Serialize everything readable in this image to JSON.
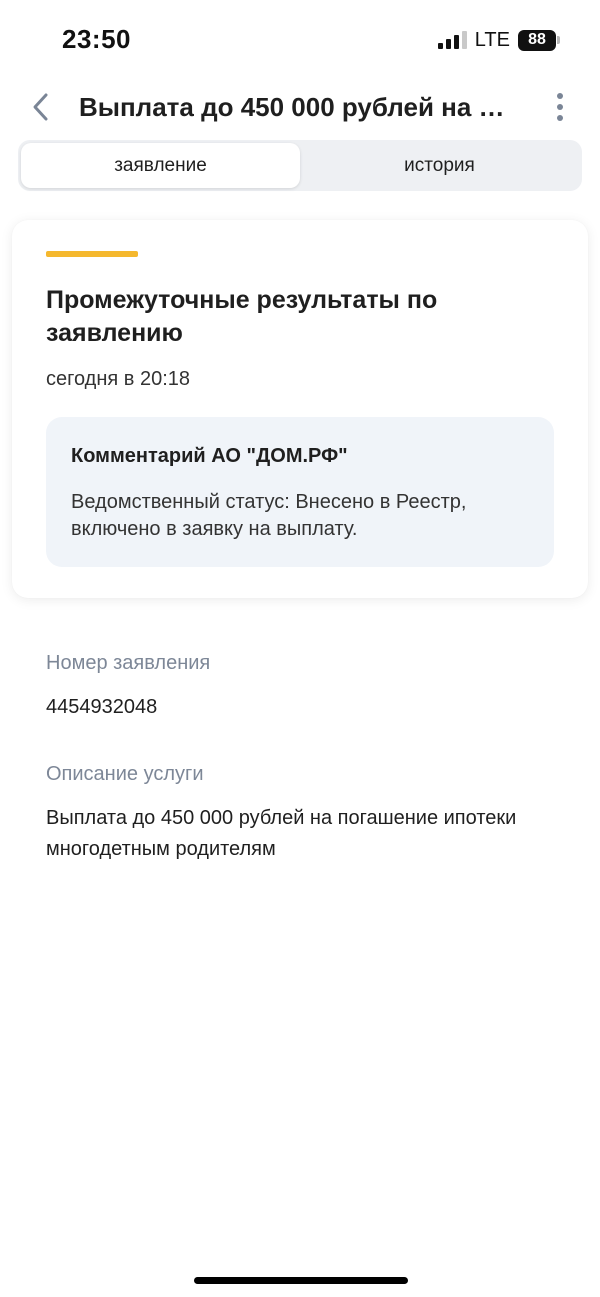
{
  "status_bar": {
    "time": "23:50",
    "network": "LTE",
    "battery": "88"
  },
  "header": {
    "back_icon": "chevron-left-icon",
    "title": "Выплата до 450 000 рублей на погашение ипотеки многодетным родителям",
    "more_icon": "more-vertical-icon"
  },
  "tabs": [
    {
      "label": "заявление",
      "active": true
    },
    {
      "label": "история",
      "active": false
    }
  ],
  "card": {
    "accent_color": "#f5b82e",
    "title": "Промежуточные результаты по заявлению",
    "date": "сегодня в 20:18",
    "comment": {
      "title": "Комментарий АО \"ДОМ.РФ\"",
      "text": "Ведомственный статус: Внесено в Реестр, включено в заявку на выплату."
    }
  },
  "details": {
    "number_label": "Номер заявления",
    "number_value": "4454932048",
    "description_label": "Описание услуги",
    "description_value": "Выплата до 450 000 рублей на погашение ипотеки многодетным родителям"
  }
}
